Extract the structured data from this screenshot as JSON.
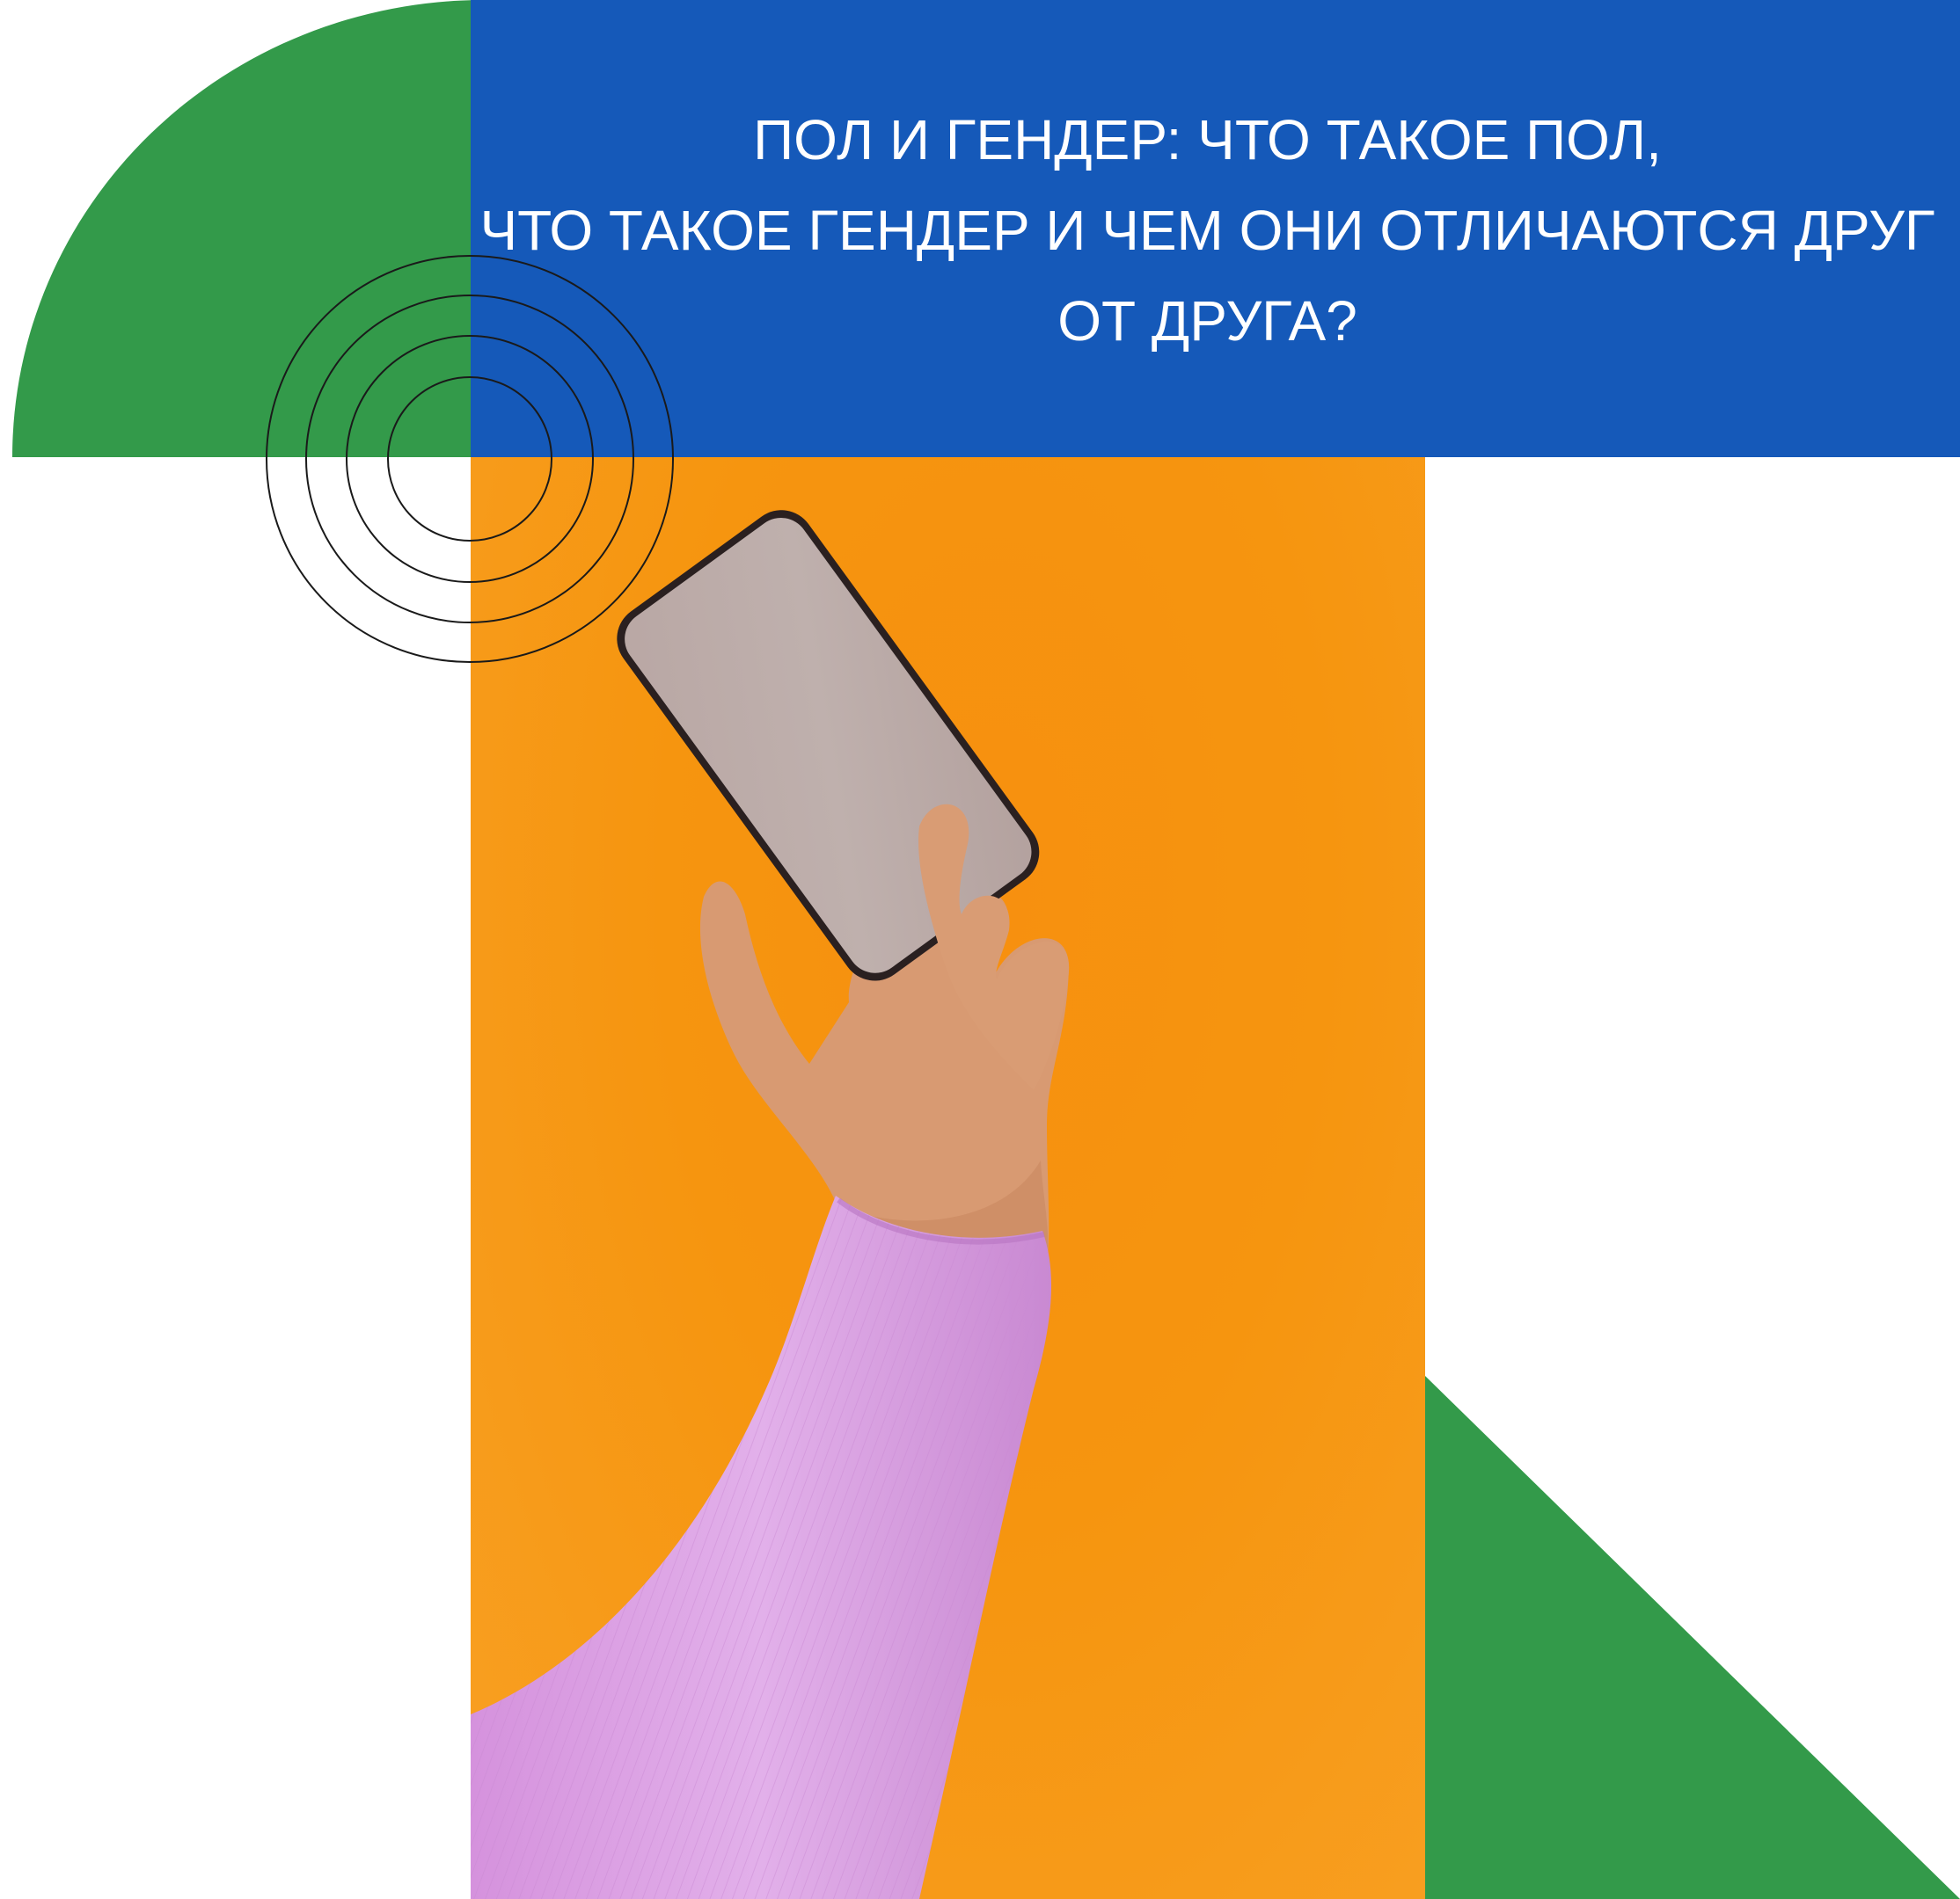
{
  "title": {
    "line1": "ПОЛ И ГЕНДЕР: ЧТО ТАКОЕ ПОЛ,",
    "line2": "ЧТО ТАКОЕ ГЕНДЕР И ЧЕМ ОНИ ОТЛИЧАЮТСЯ ДРУГ",
    "line3": "ОТ ДРУГА?"
  },
  "colors": {
    "blue": "#1559b9",
    "green": "#339a4a",
    "orange": "#f7900f",
    "sleeve": "#dca6e3",
    "skin": "#d99c74"
  },
  "icons": {
    "rings": "concentric-circles",
    "photo": "hand-holding-smartphone"
  }
}
